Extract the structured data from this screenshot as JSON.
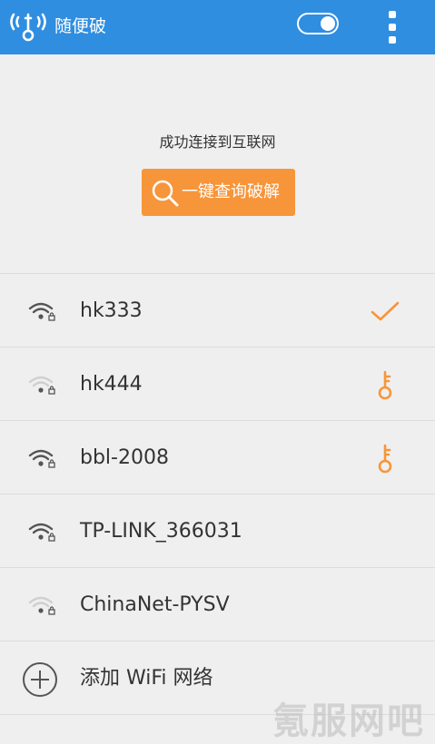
{
  "app": {
    "title": "随便破"
  },
  "header": {
    "status_text": "成功连接到互联网",
    "crack_button_label": "一键查询破解"
  },
  "networks": [
    {
      "ssid": "hk333",
      "signal": "strong",
      "status": "connected",
      "status_icon": "check-icon"
    },
    {
      "ssid": "hk444",
      "signal": "weak",
      "status": "crackable",
      "status_icon": "key-icon"
    },
    {
      "ssid": "bbl-2008",
      "signal": "strong",
      "status": "crackable",
      "status_icon": "key-icon"
    },
    {
      "ssid": "TP-LINK_366031",
      "signal": "strong",
      "status": "",
      "status_icon": ""
    },
    {
      "ssid": "ChinaNet-PYSV",
      "signal": "weak",
      "status": "",
      "status_icon": ""
    }
  ],
  "add_network": {
    "label": "添加 WiFi 网络"
  },
  "watermark": "氪服网吧",
  "colors": {
    "appbar": "#2f8ee0",
    "accent": "#f7953a",
    "background": "#efefef"
  }
}
